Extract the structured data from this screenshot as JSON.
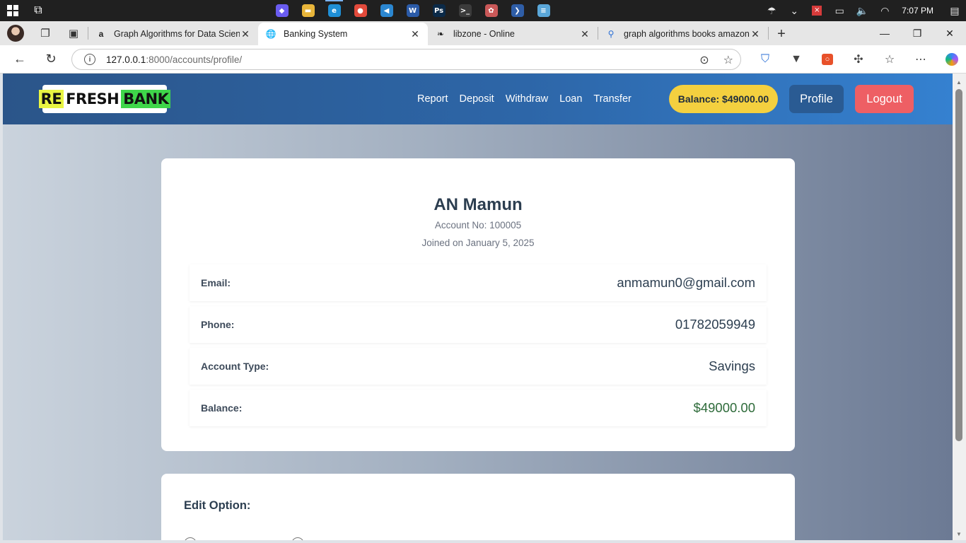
{
  "taskbar": {
    "time": "7:07 PM",
    "apps": [
      {
        "name": "copilot-app",
        "glyph": "◆",
        "color": "#6a5cf0"
      },
      {
        "name": "file-explorer-app",
        "glyph": "▬",
        "color": "#e8b53a"
      },
      {
        "name": "edge-app",
        "glyph": "e",
        "color": "#1f8fd6"
      },
      {
        "name": "chrome-app",
        "glyph": "●",
        "color": "#e24a3b"
      },
      {
        "name": "vscode-app",
        "glyph": "◀",
        "color": "#2b87d1"
      },
      {
        "name": "word-app",
        "glyph": "W",
        "color": "#2b5ba8"
      },
      {
        "name": "photoshop-app",
        "glyph": "Ps",
        "color": "#0b2a48"
      },
      {
        "name": "terminal-app",
        "glyph": ">_",
        "color": "#3b3b3b"
      },
      {
        "name": "mysql-app",
        "glyph": "✿",
        "color": "#c95858"
      },
      {
        "name": "powershell-app",
        "glyph": "❯",
        "color": "#2f5ea7"
      },
      {
        "name": "notepad-app",
        "glyph": "≡",
        "color": "#5aa7d9"
      }
    ]
  },
  "browser": {
    "tabs": [
      {
        "title": "Graph Algorithms for Data Scienc",
        "favicon": "a"
      },
      {
        "title": "Banking System",
        "favicon": "globe"
      },
      {
        "title": "libzone - Online",
        "favicon": "lib"
      },
      {
        "title": "graph algorithms books amazon -",
        "favicon": "search"
      }
    ],
    "url_host": "127.0.0.1",
    "url_path": ":8000/accounts/profile/"
  },
  "site": {
    "logo": {
      "part1": "RE",
      "part2": "FRESH",
      "part3": "BANK"
    },
    "nav": [
      "Report",
      "Deposit",
      "Withdraw",
      "Loan",
      "Transfer"
    ],
    "balance_pill": "Balance: $49000.00",
    "profile_label": "Profile",
    "logout_label": "Logout"
  },
  "profile": {
    "name": "AN Mamun",
    "account_no": "Account No: 100005",
    "joined": "Joined on January 5, 2025",
    "fields": [
      {
        "label": "Email:",
        "value": "anmamun0@gmail.com"
      },
      {
        "label": "Phone:",
        "value": "01782059949"
      },
      {
        "label": "Account Type:",
        "value": "Savings"
      },
      {
        "label": "Balance:",
        "value": "$49000.00"
      }
    ]
  },
  "edit": {
    "title": "Edit Option:"
  },
  "colors": {
    "nav_start": "#2b5589",
    "nav_end": "#3581d0",
    "balance_pill": "#f4d03f",
    "profile_button": "#2a5b93",
    "logout_button": "#ee5f64"
  }
}
